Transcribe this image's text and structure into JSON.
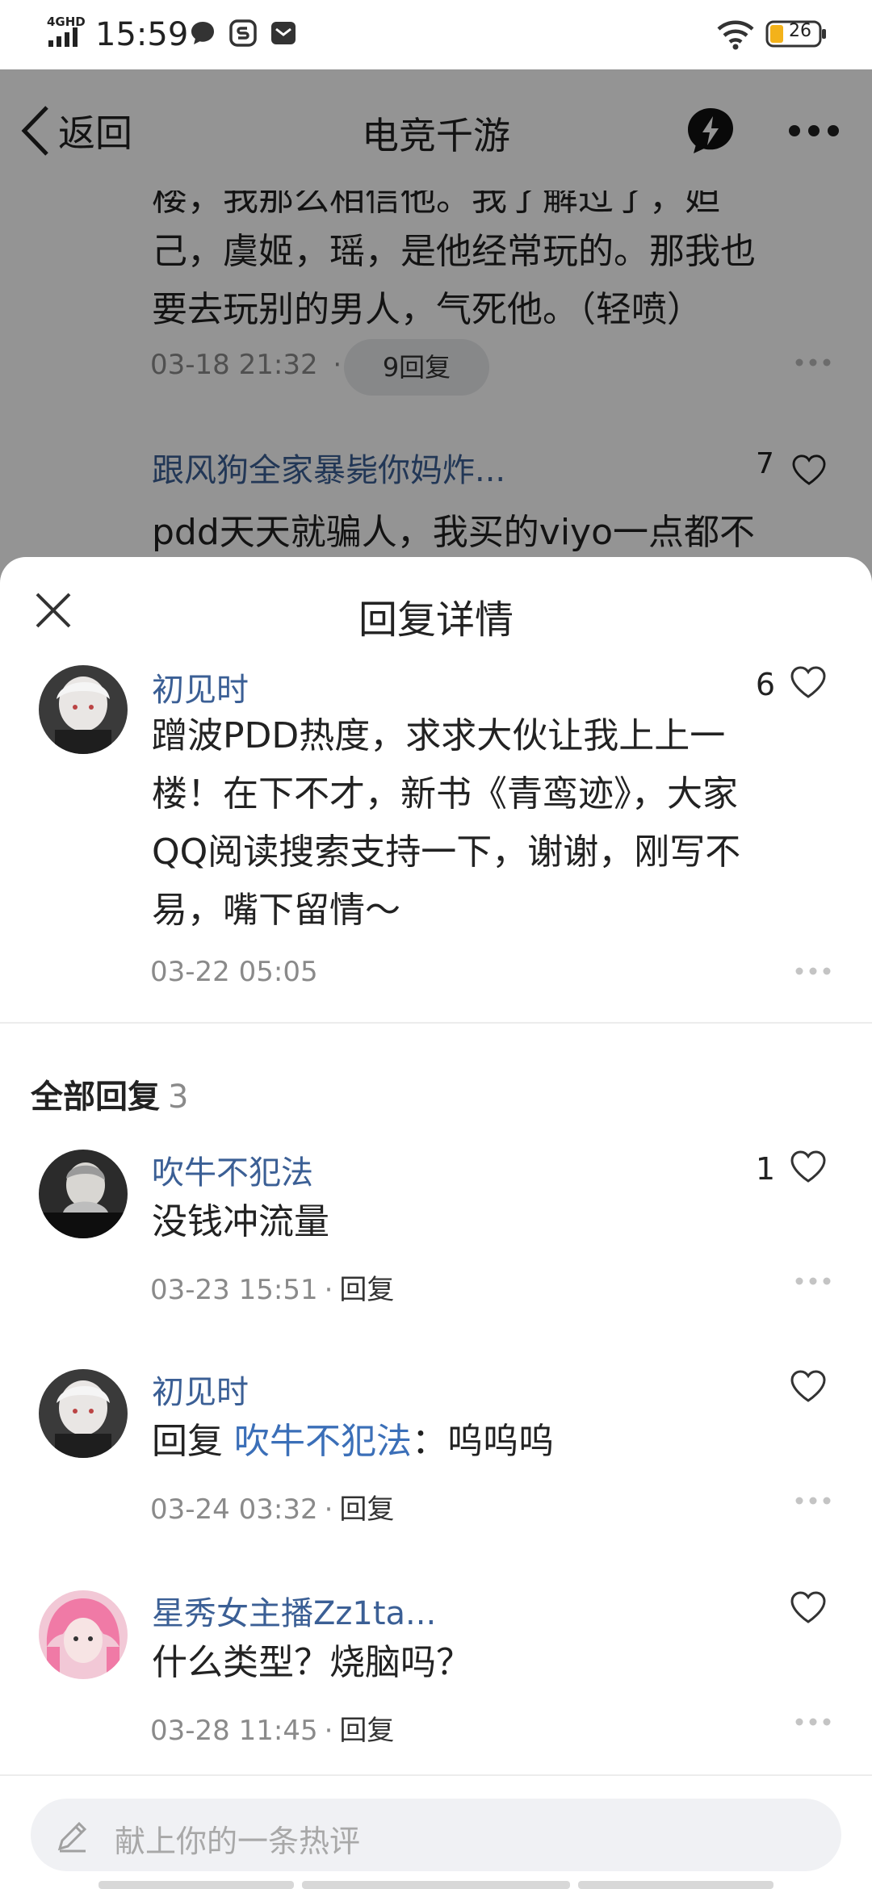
{
  "status_bar": {
    "network": "4GHD",
    "time": "15:59",
    "battery": "26"
  },
  "background_page": {
    "nav": {
      "back_label": "返回",
      "title": "电竞千游"
    },
    "clipped_line": "楼，我那么相信他。我了解过了，妲",
    "text_lines": [
      "己，虞姬，瑶，是他经常玩的。那我也",
      "要去玩别的男人，气死他。（轻喷）"
    ],
    "meta_time": "03-18 21:32",
    "meta_sep": "·",
    "reply_pill": "9回复",
    "next_author": "跟风狗全家暴毙你妈炸...",
    "next_likes": "7",
    "next_text": "pdd天天就骗人，我买的viyo一点都不"
  },
  "sheet": {
    "title": "回复详情",
    "main_comment": {
      "author": "初见时",
      "likes": "6",
      "lines": [
        "蹭波PDD热度，求求大伙让我上上一",
        "楼！在下不才，新书《青鸾迹》，大家",
        "QQ阅读搜索支持一下，谢谢，刚写不",
        "易，嘴下留情～"
      ],
      "time": "03-22 05:05"
    },
    "all_replies_label": "全部回复",
    "all_replies_count": "3",
    "replies": [
      {
        "author": "吹牛不犯法",
        "likes": "1",
        "text": "没钱冲流量",
        "time": "03-23 15:51",
        "sep": "·",
        "reply_label": "回复"
      },
      {
        "author": "初见时",
        "likes": "",
        "prefix": "回复",
        "mention": "吹牛不犯法",
        "suffix": "：呜呜呜",
        "time": "03-24 03:32",
        "sep": "·",
        "reply_label": "回复"
      },
      {
        "author": "星秀女主播Zz1ta...",
        "likes": "",
        "text": "什么类型？烧脑吗？",
        "time": "03-28 11:45",
        "sep": "·",
        "reply_label": "回复"
      }
    ],
    "input_placeholder": "献上你的一条热评"
  }
}
